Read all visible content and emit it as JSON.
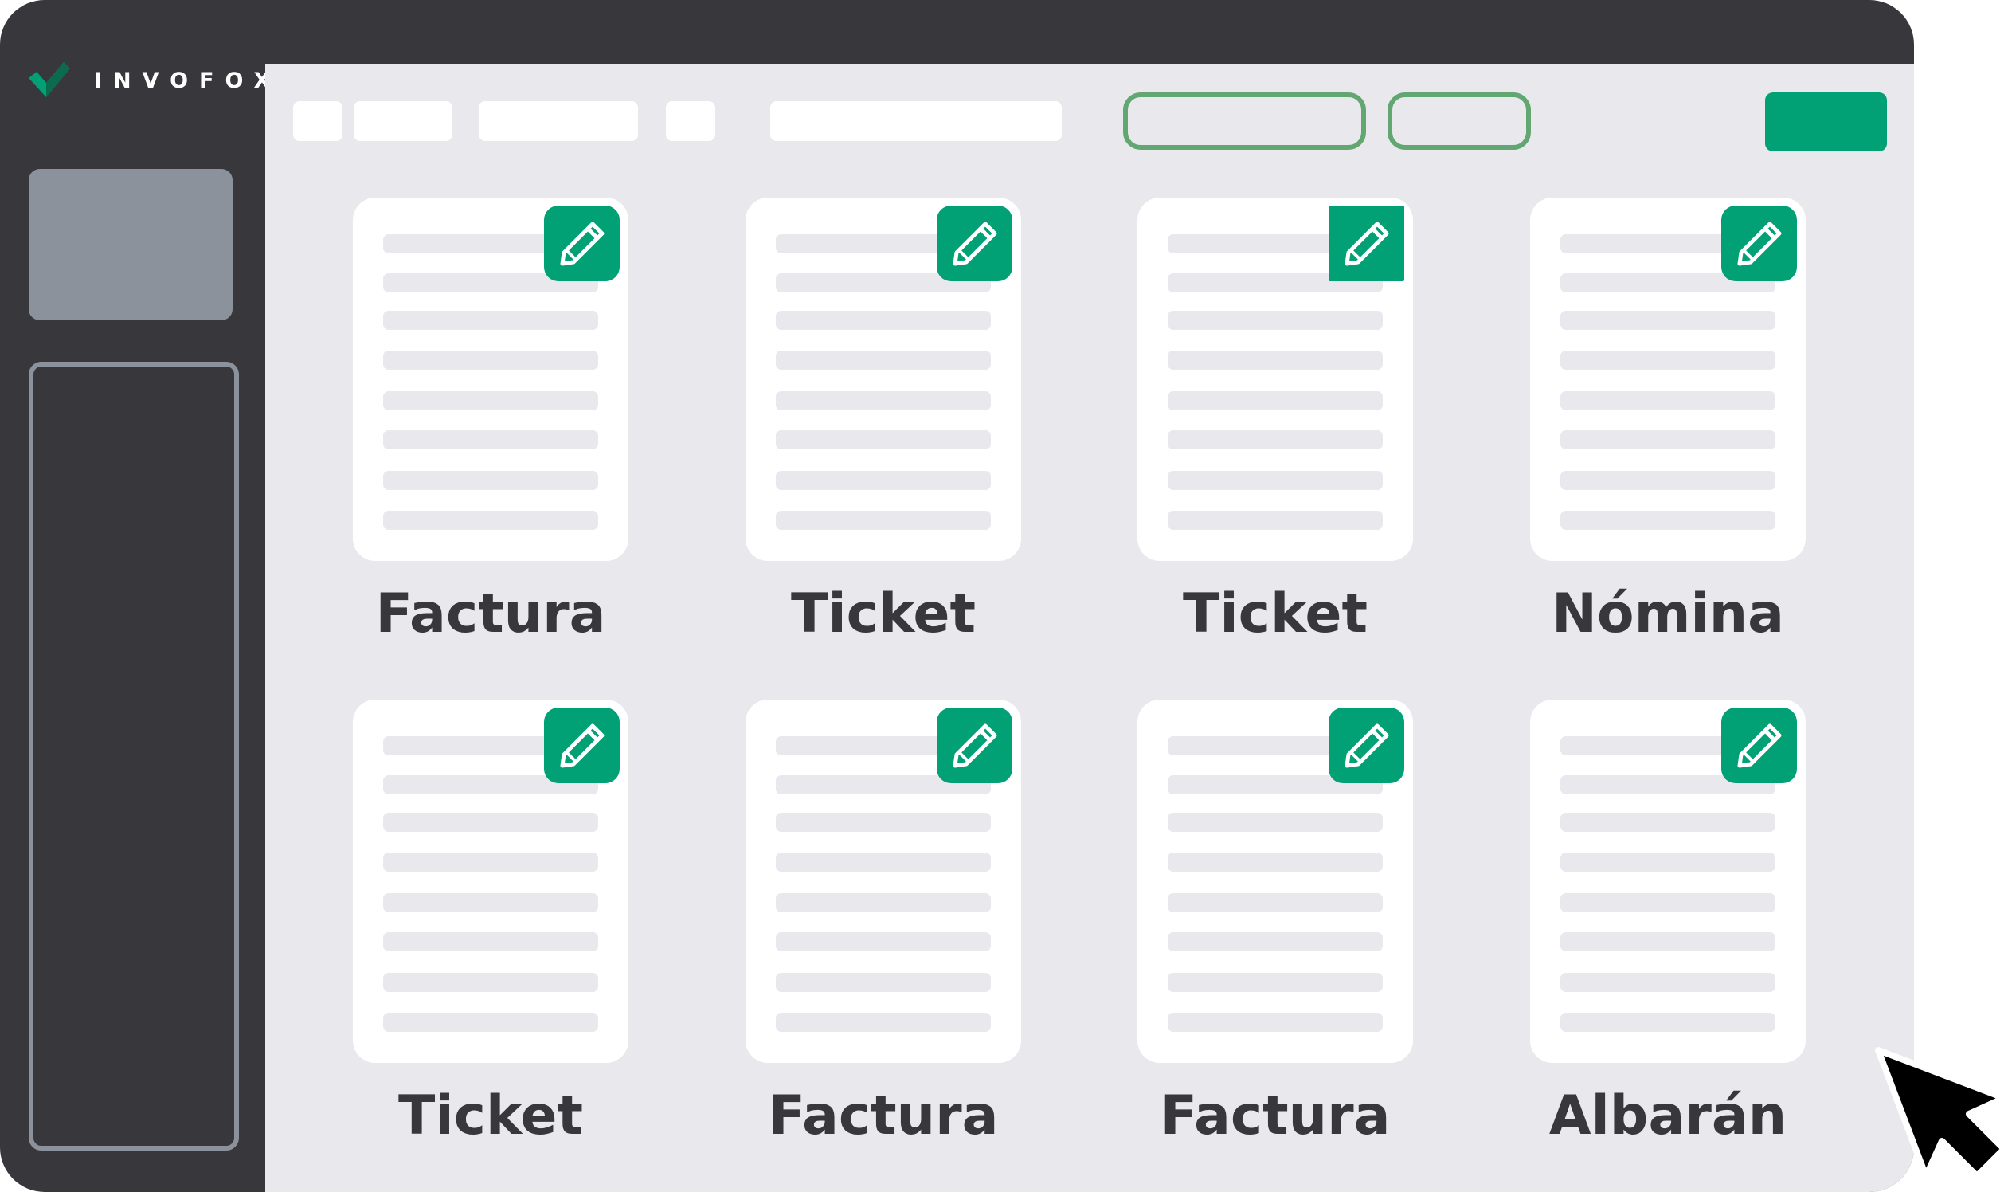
{
  "app": {
    "logo_text": "INVOFOX",
    "brand_color": "#01a075",
    "frame_color": "#38373c",
    "background_color": "#e8e8ed"
  },
  "documents": [
    {
      "label": "Factura"
    },
    {
      "label": "Ticket"
    },
    {
      "label": "Ticket"
    },
    {
      "label": "Nómina"
    },
    {
      "label": "Ticket"
    },
    {
      "label": "Factura"
    },
    {
      "label": "Factura"
    },
    {
      "label": "Albarán"
    }
  ],
  "icons": {
    "edit": "pencil-icon",
    "logo": "checkmark-logo-icon",
    "pointer": "mouse-cursor-icon"
  }
}
